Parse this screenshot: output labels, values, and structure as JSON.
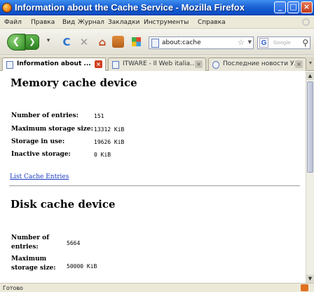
{
  "window": {
    "title": "Information about the Cache Service - Mozilla Firefox",
    "buttons": {
      "minimize": "_",
      "maximize": "□",
      "close": "×"
    }
  },
  "menu": [
    "Файл",
    "Правка",
    "Вид",
    "Журнал",
    "Закладки",
    "Инструменты",
    "Справка"
  ],
  "nav": {
    "back": "❮",
    "forward": "❯",
    "reload": "C",
    "stop": "✕",
    "home": "⌂",
    "url": "about:cache",
    "search_engine": "G",
    "search_placeholder": "Google"
  },
  "tabs": [
    {
      "label": "Information about ...",
      "active": true
    },
    {
      "label": "ITWARE - Il Web italia...",
      "active": false
    },
    {
      "label": "Последние новости У...",
      "active": false
    }
  ],
  "memory": {
    "heading": "Memory cache device",
    "rows": [
      {
        "label": "Number of entries:",
        "value": "151"
      },
      {
        "label": "Maximum storage size:",
        "value": "13312 KiB"
      },
      {
        "label": "Storage in use:",
        "value": "19626 KiB"
      },
      {
        "label": "Inactive storage:",
        "value": "0 KiB"
      }
    ],
    "link": "List Cache Entries"
  },
  "disk": {
    "heading": "Disk cache device",
    "rows": [
      {
        "label_line1": "Number of",
        "label_line2": "entries:",
        "value": "5664"
      },
      {
        "label_line1": "Maximum",
        "label_line2": "storage size:",
        "value": "50000 KiB"
      }
    ]
  },
  "status": "Готово"
}
